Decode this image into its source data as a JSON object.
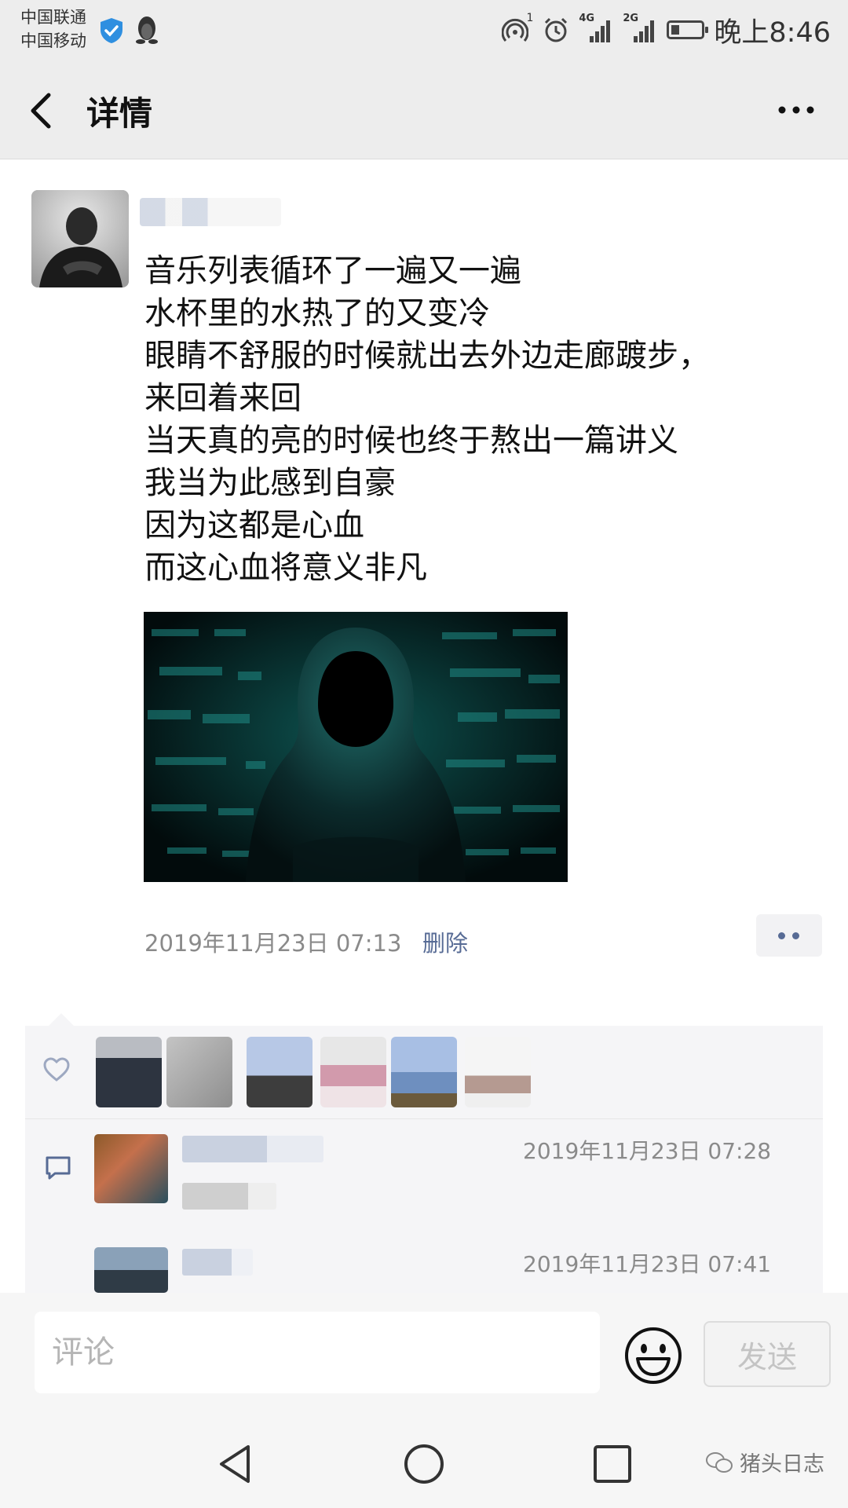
{
  "status_bar": {
    "carrier_1": "中国联通",
    "carrier_2": "中国移动",
    "hotspot_sup": "1",
    "net_4g": "4G",
    "net_2g": "2G",
    "time": "晚上8:46"
  },
  "header": {
    "title": "详情"
  },
  "post": {
    "lines": [
      "音乐列表循环了一遍又一遍",
      "水杯里的水热了的又变冷",
      "眼睛不舒服的时候就出去外边走廊踱步，",
      "来回着来回",
      "当天真的亮的时候也终于熬出一篇讲义",
      "我当为此感到自豪",
      "因为这都是心血",
      "而这心血将意义非凡"
    ],
    "timestamp": "2019年11月23日 07:13",
    "delete_label": "删除"
  },
  "comments": [
    {
      "time": "2019年11月23日 07:28"
    },
    {
      "time": "2019年11月23日 07:41"
    }
  ],
  "comment_bar": {
    "placeholder": "评论",
    "send_label": "发送"
  },
  "watermark": {
    "text": "猪头日志"
  },
  "colors": {
    "link": "#576b95",
    "meta": "#8a8a8a",
    "bar_bg": "#ededed"
  }
}
